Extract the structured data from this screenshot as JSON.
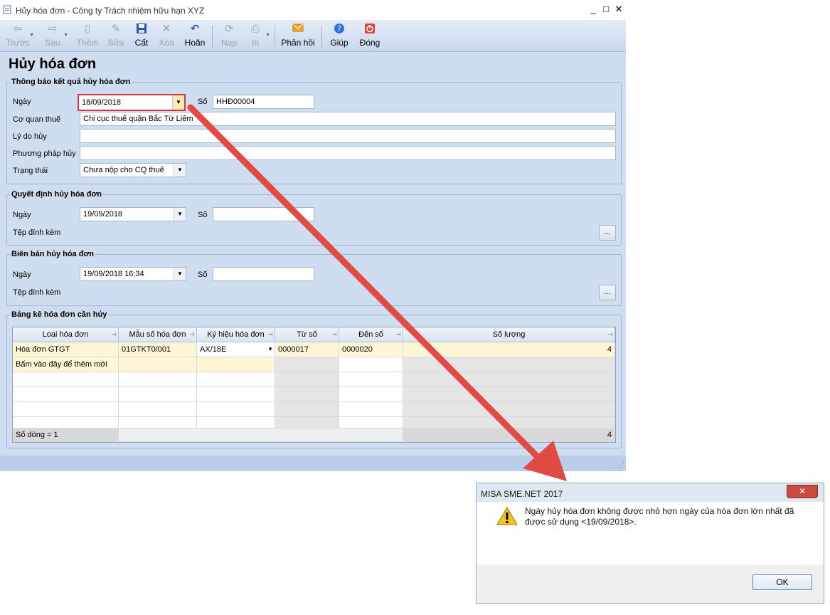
{
  "window": {
    "title": "Hủy hóa đơn - Công ty Trách nhiệm hữu hạn XYZ",
    "controls": [
      "_",
      "□",
      "✕"
    ]
  },
  "toolbar": {
    "items": [
      {
        "label": "Trước",
        "icon": "arrow-left-icon",
        "enabled": false
      },
      {
        "label": "Sau",
        "icon": "arrow-right-icon",
        "enabled": false
      },
      {
        "label": "Thêm",
        "icon": "add-document-icon",
        "enabled": false
      },
      {
        "label": "Sửa",
        "icon": "edit-icon",
        "enabled": false
      },
      {
        "label": "Cất",
        "icon": "save-icon",
        "enabled": true
      },
      {
        "label": "Xóa",
        "icon": "delete-icon",
        "enabled": false
      },
      {
        "label": "Hoãn",
        "icon": "undo-icon",
        "enabled": true
      },
      {
        "label": "Nạp",
        "icon": "reload-icon",
        "enabled": false
      },
      {
        "label": "In",
        "icon": "print-icon",
        "enabled": false
      },
      {
        "label": "Phản hồi",
        "icon": "envelope-icon",
        "enabled": true
      },
      {
        "label": "Giúp",
        "icon": "help-icon",
        "enabled": true
      },
      {
        "label": "Đóng",
        "icon": "power-icon",
        "enabled": true
      }
    ]
  },
  "page_title": "Hủy hóa đơn",
  "notice": {
    "legend": "Thông báo kết quả hủy hóa đơn",
    "date_label": "Ngày",
    "date_value": "18/09/2018",
    "number_label": "Số",
    "number_value": "HHĐ00004",
    "tax_office_label": "Cơ quan thuế",
    "tax_office_value": "Chi cục thuế quận Bắc Từ Liêm",
    "reason_label": "Lý do hủy",
    "reason_value": "",
    "method_label": "Phương pháp hủy",
    "method_value": "",
    "status_label": "Trạng thái",
    "status_value": "Chưa nộp cho CQ thuế"
  },
  "decision": {
    "legend": "Quyết định hủy hóa đơn",
    "date_label": "Ngày",
    "date_value": "19/09/2018",
    "number_label": "Số",
    "number_value": "",
    "attach_label": "Tệp đính kèm",
    "attach_button": "..."
  },
  "minutes": {
    "legend": "Biên bản hủy hóa đơn",
    "date_label": "Ngày",
    "date_value": "19/09/2018 16:34",
    "number_label": "Số",
    "number_value": "",
    "attach_label": "Tệp đính kèm",
    "attach_button": "..."
  },
  "invoices": {
    "legend": "Bảng kê hóa đơn cần hủy",
    "columns": [
      "Loại hóa đơn",
      "Mẫu số hóa đơn",
      "Ký hiệu hóa đơn",
      "Từ số",
      "Đến số",
      "Số lượng"
    ],
    "rows": [
      {
        "type": "Hóa đơn GTGT",
        "template": "01GTKT0/001",
        "symbol": "AX/18E",
        "from": "0000017",
        "to": "0000020",
        "quantity": "4"
      }
    ],
    "add_new_text": "Bấm vào đây để thêm mới",
    "row_count_text": "Số dòng = 1",
    "total_quantity": "4"
  },
  "dialog": {
    "title": "MISA SME.NET 2017",
    "close_label": "✕",
    "message": "Ngày hủy hóa đơn không được nhỏ hơn ngày của hóa đơn lớn nhất đã được sử dụng <19/09/2018>.",
    "ok_label": "OK"
  },
  "colors": {
    "highlight": "#d9363e",
    "arrow": "#e24a44",
    "window_bg": "#cfddf0",
    "row_yellow": "#fff6d5"
  }
}
